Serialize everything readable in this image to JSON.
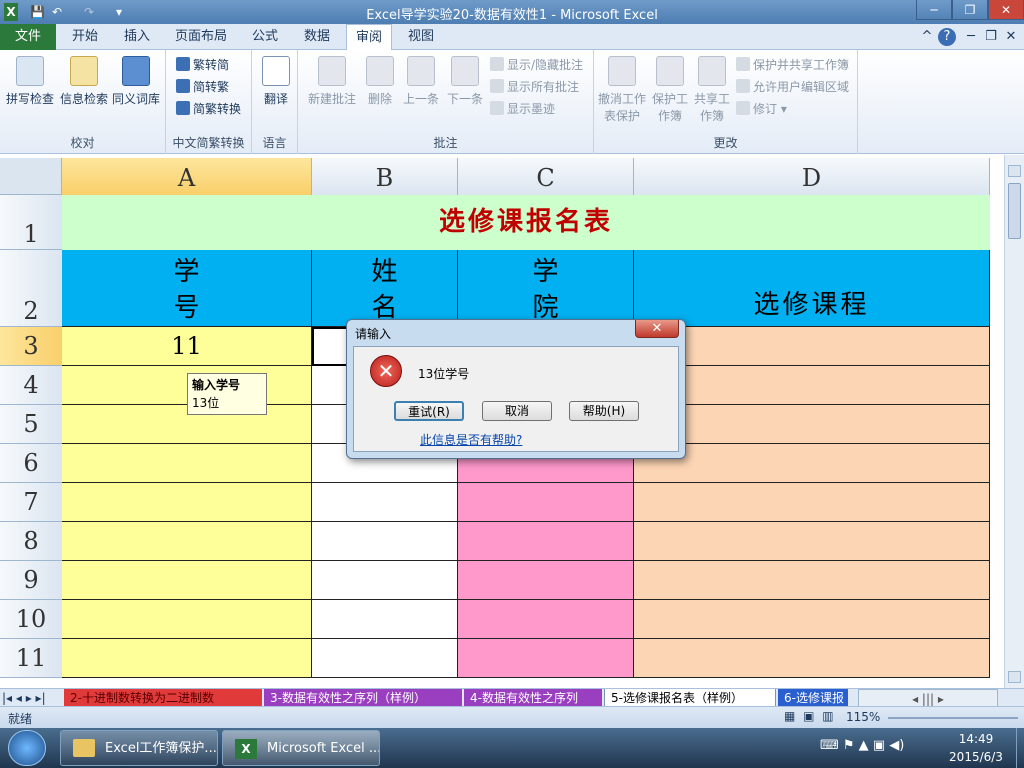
{
  "window": {
    "title": "Excel导学实验20-数据有效性1 - Microsoft Excel"
  },
  "tabs": [
    "文件",
    "开始",
    "插入",
    "页面布局",
    "公式",
    "数据",
    "审阅",
    "视图"
  ],
  "ribbon": {
    "proofing": {
      "group": "校对",
      "buttons": [
        "拼写检查",
        "信息检索",
        "同义词库"
      ]
    },
    "chinese": {
      "group": "中文简繁转换",
      "buttons": [
        "繁转简",
        "简转繁",
        "简繁转换"
      ]
    },
    "language": {
      "group": "语言",
      "buttons": [
        "翻译"
      ]
    },
    "comments": {
      "group": "批注",
      "buttons": [
        "新建批注",
        "删除",
        "上一条",
        "下一条"
      ],
      "small": [
        "显示/隐藏批注",
        "显示所有批注",
        "显示墨迹"
      ]
    },
    "changes": {
      "group": "更改",
      "buttons": [
        "撤消工作表保护",
        "保护工作簿",
        "共享工作簿"
      ],
      "small": [
        "保护并共享工作簿",
        "允许用户编辑区域",
        "修订"
      ]
    }
  },
  "sheet": {
    "columns": [
      "A",
      "B",
      "C",
      "D"
    ],
    "rows": [
      "1",
      "2",
      "3",
      "4",
      "5",
      "6",
      "7",
      "8",
      "9",
      "10",
      "11"
    ],
    "title": "选修课报名表",
    "headers": {
      "a": "学号",
      "b": "姓名",
      "c": "学院",
      "d": "选修课程"
    },
    "a3": "11"
  },
  "tooltip": {
    "title": "输入学号",
    "text": "13位"
  },
  "dialog": {
    "title": "请输入",
    "message": "13位学号",
    "retry": "重试(R)",
    "cancel": "取消",
    "help": "帮助(H)",
    "link": "此信息是否有帮助?"
  },
  "sheet_tabs": [
    "2-十进制数转换为二进制数",
    "3-数据有效性之序列（样例）",
    "4-数据有效性之序列",
    "5-选修课报名表（样例）",
    "6-选修课报"
  ],
  "status": {
    "ready": "就绪",
    "zoom": "115%"
  },
  "taskbar": {
    "items": [
      "Excel工作簿保护...",
      "Microsoft Excel ..."
    ],
    "time": "14:49",
    "date": "2015/6/3"
  },
  "colors": {
    "accent": "#2b7a3b",
    "title_red": "#c00000",
    "header_cyan": "#00b0f0",
    "col_a": "#ffff99",
    "col_c": "#ff99cc",
    "col_d": "#fcd5b4",
    "row1": "#ccffcc"
  }
}
